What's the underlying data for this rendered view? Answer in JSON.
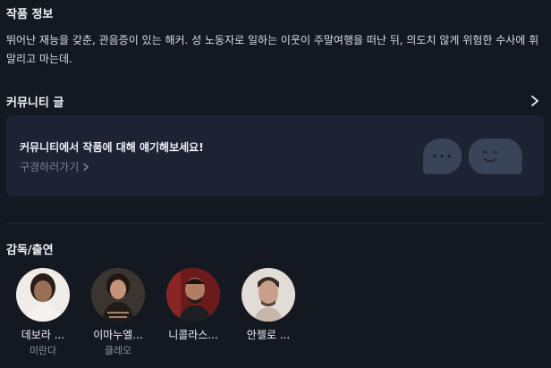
{
  "info": {
    "title": "작품 정보",
    "synopsis": "뛰어난 재능을 갖춘, 관음증이 있는 해커. 성 노동자로 일하는 이웃이 주말여행을 떠난 뒤, 의도치 않게 위험한 수사에 휘말리고 마는데."
  },
  "community": {
    "title": "커뮤니티 글",
    "chevron_icon": "chevron-right-icon",
    "card_heading": "커뮤니티에서 작품에 대해 얘기해보세요!",
    "card_link": "구경하러가기",
    "illustration": "chat-bubbles-icon"
  },
  "cast": {
    "title": "감독/출연",
    "people": [
      {
        "name": "데보라 ...",
        "role": "미란다",
        "avatar_color": "#e9e4df"
      },
      {
        "name": "이마누엘...",
        "role": "클레오",
        "avatar_color": "#a88b77"
      },
      {
        "name": "니콜라스...",
        "role": "",
        "avatar_color": "#7a1f1f"
      },
      {
        "name": "안젤로 ...",
        "role": "",
        "avatar_color": "#d9d2cc"
      }
    ]
  },
  "colors": {
    "background": "#141820",
    "card": "#1d2333",
    "muted_text": "#7b8394"
  }
}
